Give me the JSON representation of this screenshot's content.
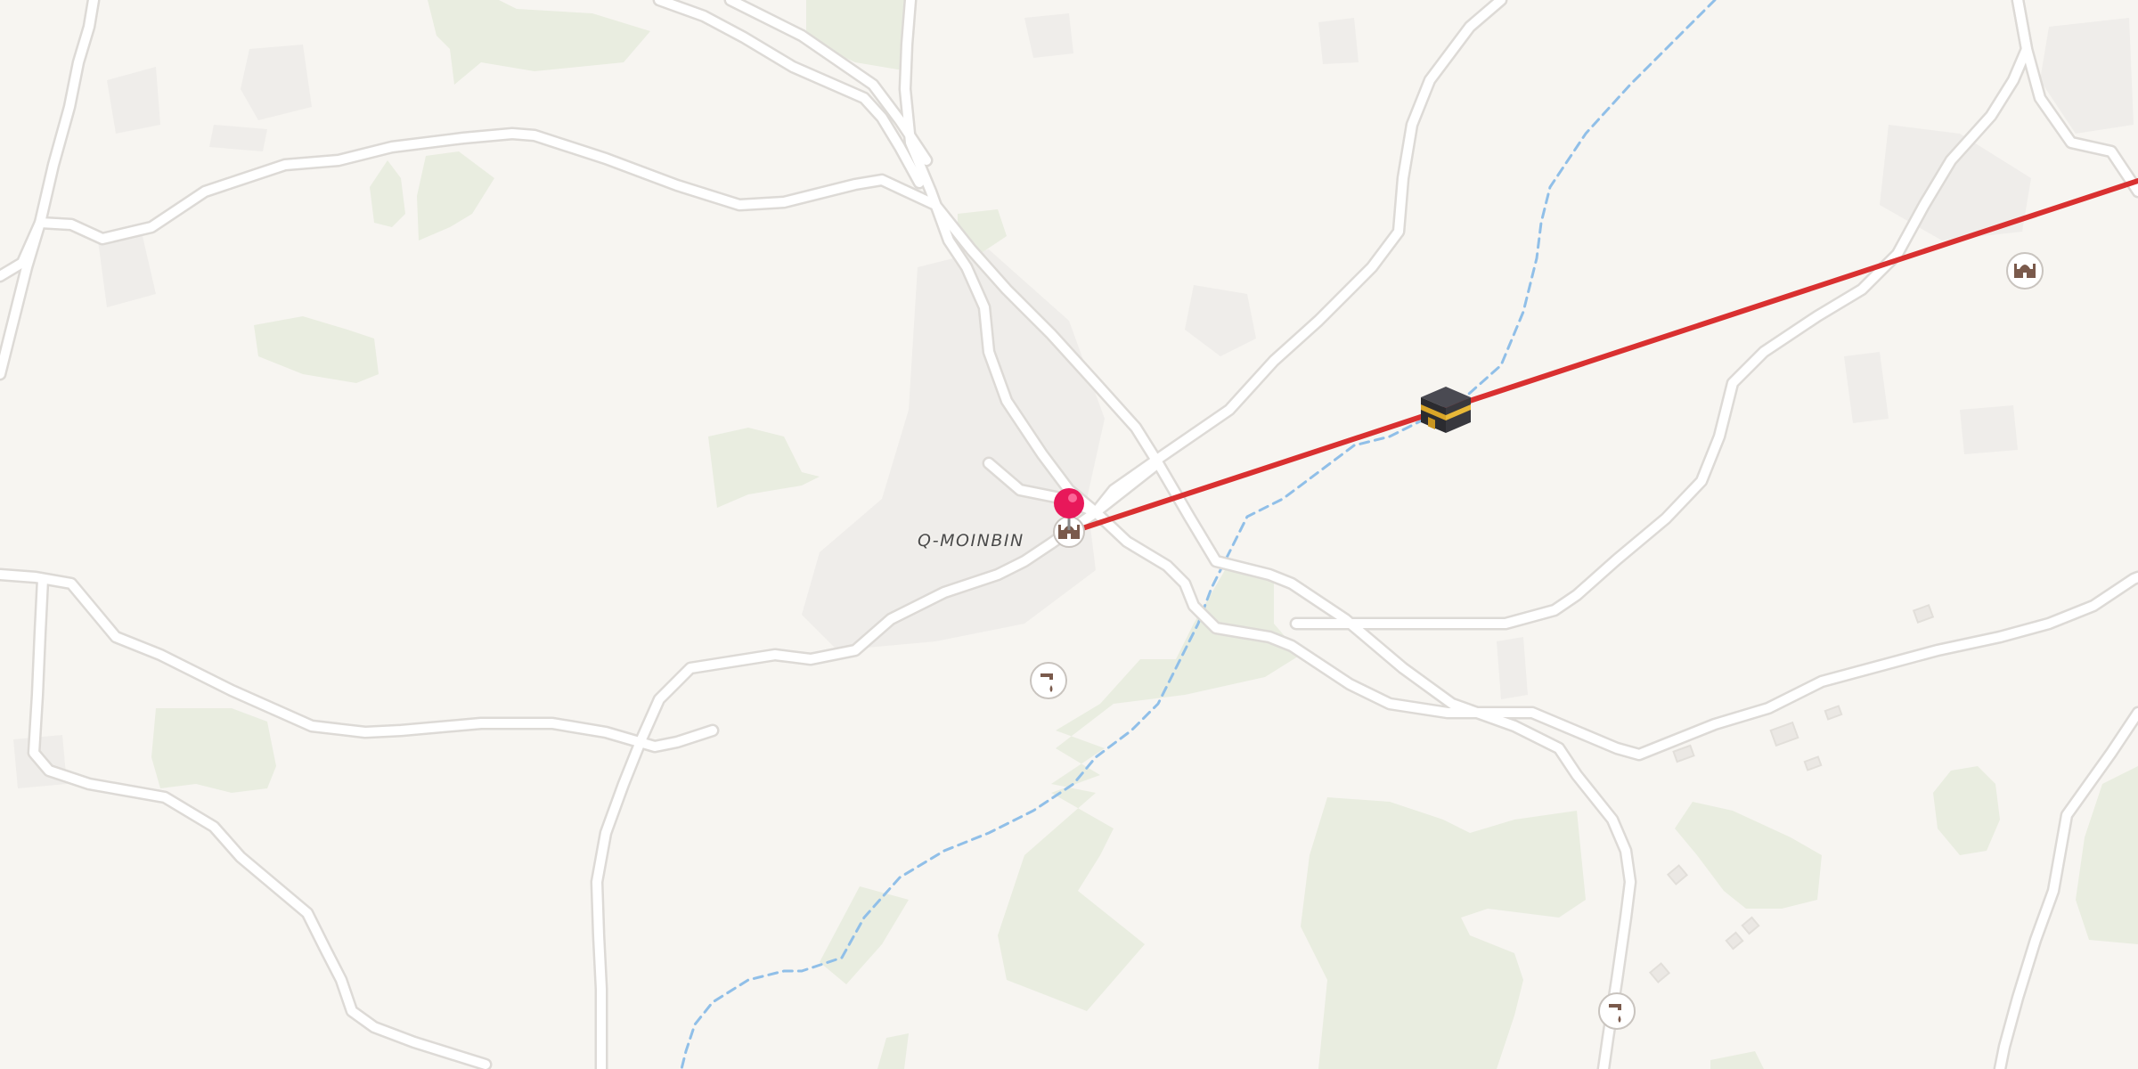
{
  "map": {
    "place_label": "Q-MOINBIN",
    "colors": {
      "background": "#f7f5f1",
      "vegetation": "#e9ede0",
      "settlement": "#efedea",
      "building": "#ebe8e4",
      "road_casing": "#dddad6",
      "road_fill": "#ffffff",
      "waterway": "#90bfe8",
      "qibla_line": "#d93030",
      "pin": "#e8185a"
    },
    "markers": [
      {
        "type": "location-pin",
        "icon": "map-pin-icon"
      },
      {
        "type": "mosque",
        "icon": "mosque-icon"
      },
      {
        "type": "kaaba",
        "icon": "kaaba-icon"
      },
      {
        "type": "water-tap",
        "icon": "water-tap-icon"
      },
      {
        "type": "water-tap",
        "icon": "water-tap-icon"
      },
      {
        "type": "mosque",
        "icon": "mosque-icon"
      }
    ],
    "overlay": {
      "type": "qibla-direction-line"
    }
  }
}
